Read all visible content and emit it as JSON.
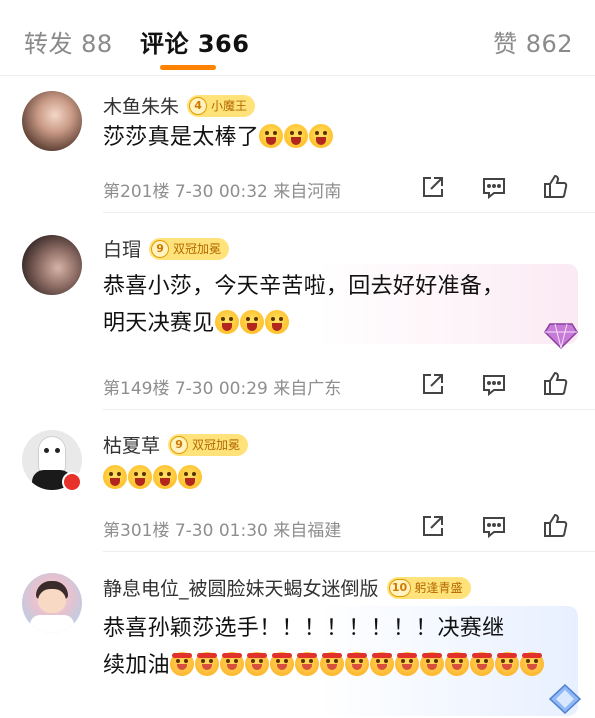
{
  "tabs": {
    "repost": "转发 88",
    "comments": "评论 366",
    "likes": "赞 862"
  },
  "comments": [
    {
      "username": "木鱼朱朱",
      "badge_level": "4",
      "badge_text": "小魔王",
      "text": "莎莎真是太棒了",
      "meta": "第201楼 7-30 00:32 来自河南"
    },
    {
      "username": "白瑁",
      "badge_level": "9",
      "badge_text": "双冠加冕",
      "text_line1": "恭喜小莎，今天辛苦啦，回去好好准备，",
      "text_line2": "明天决赛见",
      "meta": "第149楼 7-30 00:29 来自广东"
    },
    {
      "username": "枯夏草",
      "badge_level": "9",
      "badge_text": "双冠加冕",
      "meta": "第301楼 7-30 01:30 来自福建"
    },
    {
      "username": "静息电位_被圆脸妹天蝎女迷倒版",
      "badge_level": "10",
      "badge_text": "躬逢青盛",
      "text_line1": "恭喜孙颖莎选手！！！！！！！！决赛继",
      "text_line2": "续加油"
    }
  ],
  "colors": {
    "accent": "#ff8200",
    "badge": "#ffe27a",
    "meta": "#8e8e8e"
  }
}
